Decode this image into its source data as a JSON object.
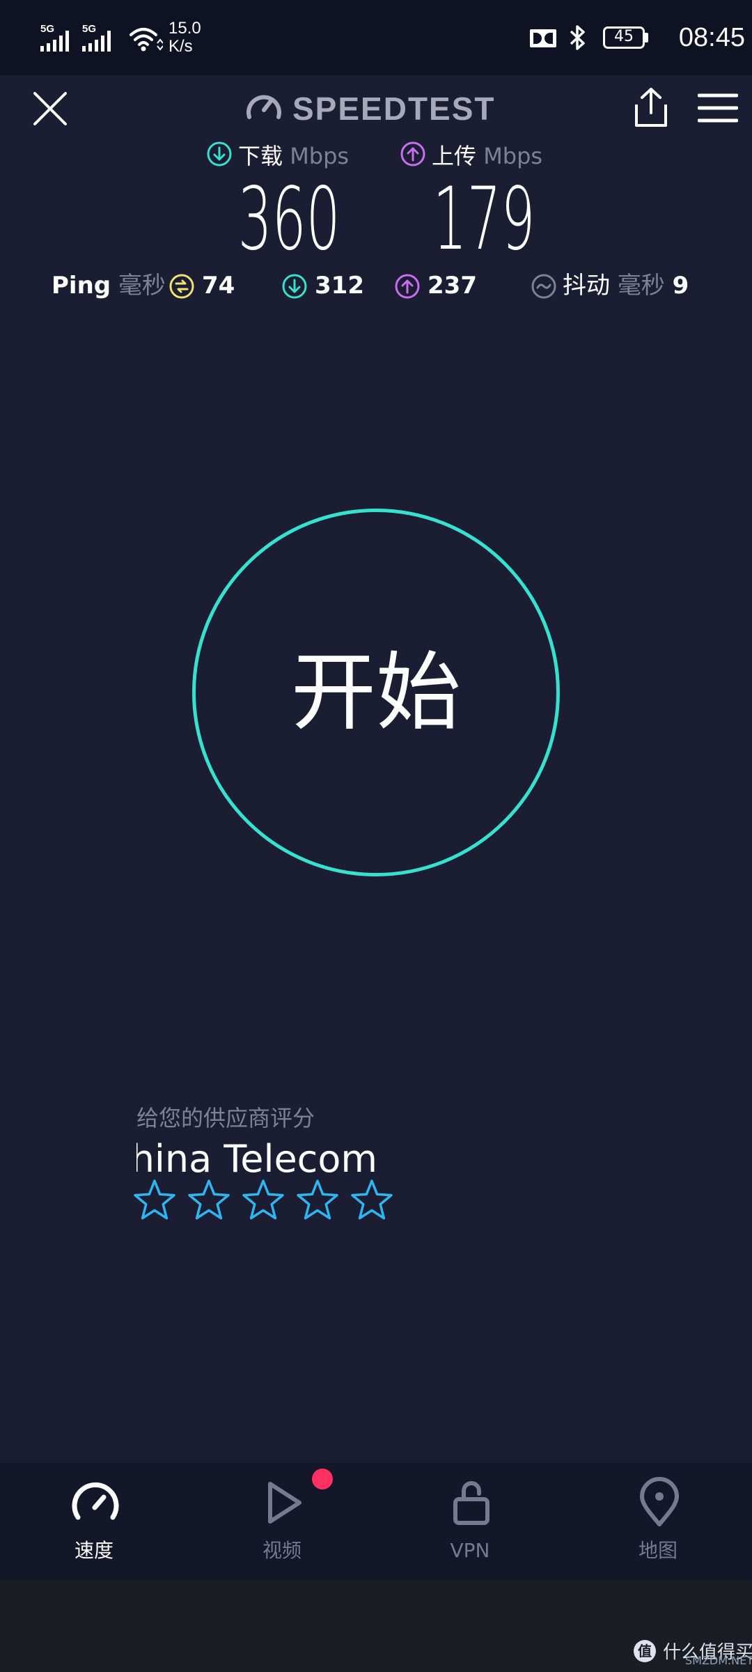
{
  "status_bar": {
    "signal1": "5G",
    "signal2": "5G",
    "net_speed_value": "15.0",
    "net_speed_unit": "K/s",
    "battery": "45",
    "time": "08:45"
  },
  "header": {
    "title": "SPEEDTEST"
  },
  "results": {
    "download_label": "下载",
    "upload_label": "上传",
    "unit": "Mbps",
    "download_value": "360",
    "upload_value": "179"
  },
  "stats": {
    "ping_label": "Ping",
    "ping_unit": "毫秒",
    "ping_value": "74",
    "download_ping": "312",
    "upload_ping": "237",
    "jitter_label": "抖动",
    "jitter_unit": "毫秒",
    "jitter_value": "9"
  },
  "start_button": {
    "label": "开始"
  },
  "rating": {
    "prompt": "给您的供应商评分",
    "provider": "China Telecom",
    "stars": 5,
    "selected": 0
  },
  "bottom_nav": {
    "items": [
      {
        "label": "速度",
        "icon": "speedometer-icon",
        "active": true
      },
      {
        "label": "视频",
        "icon": "play-icon",
        "active": false
      },
      {
        "label": "VPN",
        "icon": "lock-icon",
        "active": false
      },
      {
        "label": "地图",
        "icon": "map-pin-icon",
        "active": false
      }
    ]
  },
  "watermark": {
    "text": "什么值得买",
    "url": "SMZDM.NET"
  },
  "colors": {
    "background": "#1b1e33",
    "accent_teal": "#36e2cf",
    "accent_purple": "#c86ef0",
    "ping_yellow": "#f1e36d",
    "star_blue": "#2fb6f1",
    "badge_red": "#ff3163"
  }
}
